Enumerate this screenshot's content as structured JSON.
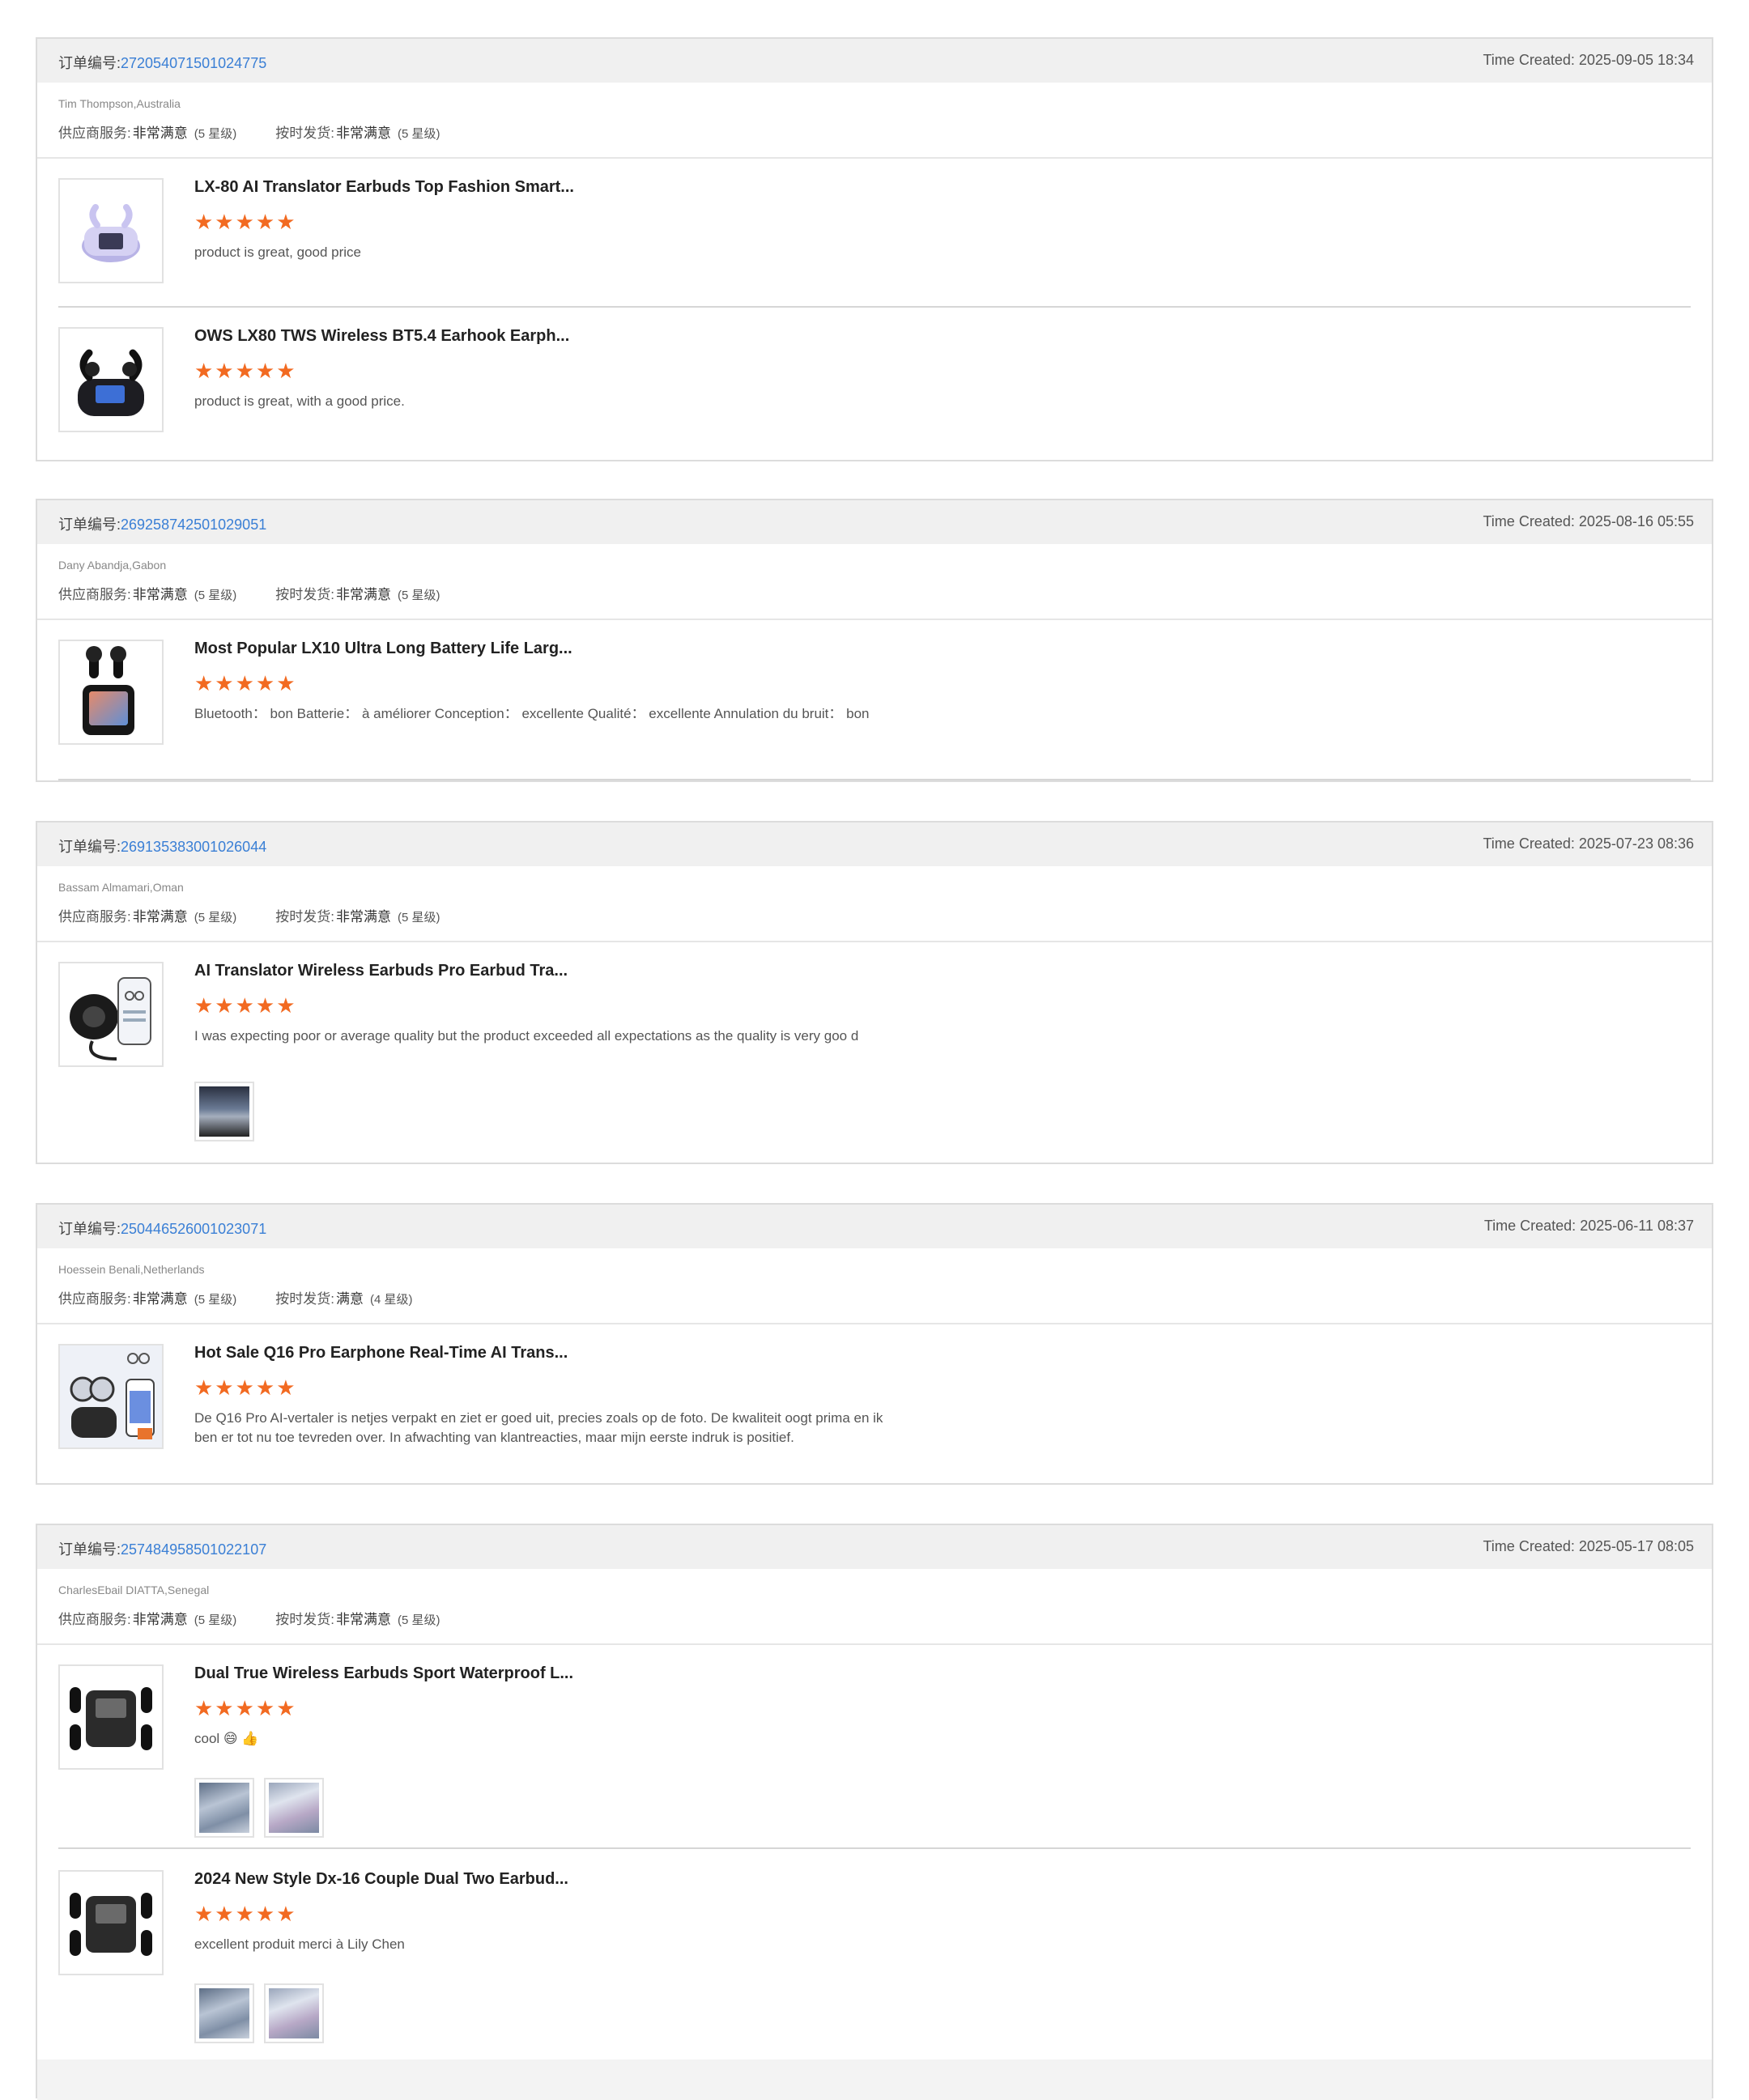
{
  "order_label": "订单编号:",
  "created_label": "Time Created:",
  "orders": [
    {
      "order_no": "272054071501024775",
      "created": "2025-09-05 18:34",
      "buyer": "Tim Thompson,Australia",
      "supplier_label": "供应商服务:",
      "supplier_value": "非常满意",
      "supplier_stars": "(5 星级)",
      "shipping_label": "按时发货:",
      "shipping_value": "非常满意",
      "shipping_stars": "(5 星级)",
      "items": [
        {
          "title": "LX-80 AI Translator Earbuds Top Fashion Smart...",
          "stars": "★★★★★",
          "comment": "product is great, good price"
        },
        {
          "title": "OWS LX80 TWS Wireless BT5.4 Earhook Earph...",
          "stars": "★★★★★",
          "comment": "product is great, with a good price."
        }
      ]
    },
    {
      "order_no": "269258742501029051",
      "created": "2025-08-16 05:55",
      "buyer": "Dany Abandja,Gabon",
      "supplier_label": "供应商服务:",
      "supplier_value": "非常满意",
      "supplier_stars": "(5 星级)",
      "shipping_label": "按时发货:",
      "shipping_value": "非常满意",
      "shipping_stars": "(5 星级)",
      "items": [
        {
          "title": "Most Popular LX10 Ultra Long Battery Life Larg...",
          "stars": "★★★★★",
          "comment": "Bluetooth： bon Batterie： à améliorer Conception： excellente Qualité： excellente Annulation du bruit： bon"
        }
      ]
    },
    {
      "order_no": "269135383001026044",
      "created": "2025-07-23 08:36",
      "buyer": "Bassam Almamari,Oman",
      "supplier_label": "供应商服务:",
      "supplier_value": "非常满意",
      "supplier_stars": "(5 星级)",
      "shipping_label": "按时发货:",
      "shipping_value": "非常满意",
      "shipping_stars": "(5 星级)",
      "items": [
        {
          "title": "AI Translator Wireless Earbuds Pro Earbud Tra...",
          "stars": "★★★★★",
          "comment": "I was expecting poor or average quality but the product exceeded all expectations as the quality is very goo d"
        }
      ]
    },
    {
      "order_no": "250446526001023071",
      "created": "2025-06-11 08:37",
      "buyer": "Hoessein Benali,Netherlands",
      "supplier_label": "供应商服务:",
      "supplier_value": "非常满意",
      "supplier_stars": "(5 星级)",
      "shipping_label": "按时发货:",
      "shipping_value": "满意",
      "shipping_stars": "(4 星级)",
      "items": [
        {
          "title": "Hot Sale Q16 Pro Earphone Real-Time AI Trans...",
          "stars": "★★★★★",
          "comment": "De Q16 Pro AI-vertaler is netjes verpakt en ziet er goed uit, precies zoals op de foto. De kwaliteit oogt prima en ik ben er tot nu toe tevreden over. In afwachting van klantreacties, maar mijn eerste indruk is positief."
        }
      ]
    },
    {
      "order_no": "257484958501022107",
      "created": "2025-05-17 08:05",
      "buyer": "CharlesEbail DIATTA,Senegal",
      "supplier_label": "供应商服务:",
      "supplier_value": "非常满意",
      "supplier_stars": "(5 星级)",
      "shipping_label": "按时发货:",
      "shipping_value": "非常满意",
      "shipping_stars": "(5 星级)",
      "items": [
        {
          "title": "Dual True Wireless Earbuds Sport Waterproof L...",
          "stars": "★★★★★",
          "comment": "cool 😄 👍"
        },
        {
          "title": "2024 New Style Dx-16 Couple Dual Two Earbud...",
          "stars": "★★★★★",
          "comment": "excellent produit merci à Lily Chen"
        }
      ]
    }
  ]
}
